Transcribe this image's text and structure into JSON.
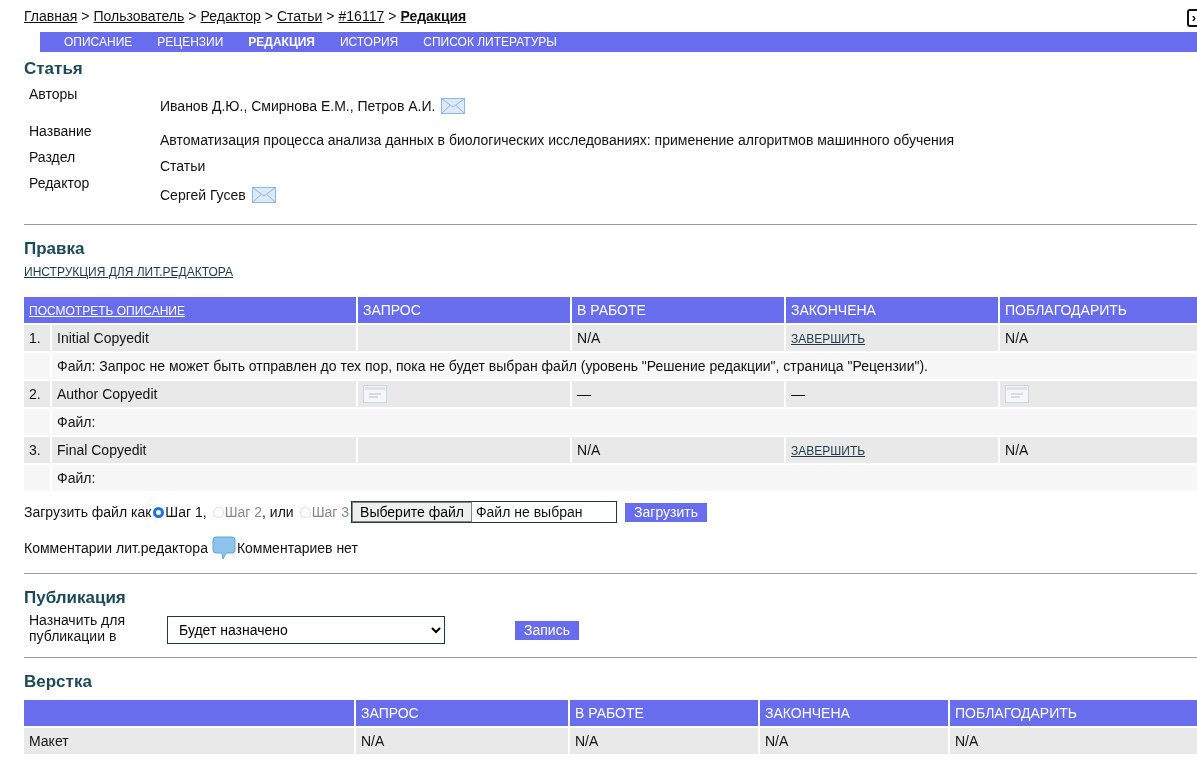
{
  "breadcrumbs": [
    {
      "label": "Главная",
      "current": false
    },
    {
      "label": "Пользователь",
      "current": false
    },
    {
      "label": "Редактор",
      "current": false
    },
    {
      "label": "Статьи",
      "current": false
    },
    {
      "label": "#16117",
      "current": false
    },
    {
      "label": "Редакция",
      "current": true
    }
  ],
  "separator": ">",
  "expand_button": {
    "label": "›"
  },
  "tabs": [
    {
      "label": "ОПИСАНИЕ",
      "selected": false
    },
    {
      "label": "РЕЦЕНЗИИ",
      "selected": false
    },
    {
      "label": "РЕДАКЦИЯ",
      "selected": true
    },
    {
      "label": "ИСТОРИЯ",
      "selected": false
    },
    {
      "label": "СПИСОК ЛИТЕРАТУРЫ",
      "selected": false
    }
  ],
  "article": {
    "heading": "Статья",
    "fields": [
      {
        "label": "Авторы",
        "value": "Иванов Д.Ю., Смирнова Е.М., Петров А.И.",
        "mail": true
      },
      {
        "label": "Название",
        "value": "Автоматизация процесса анализа данных в биологических исследованиях: применение алгоритмов машинного обучения",
        "mail": false
      },
      {
        "label": "Раздел",
        "value": "Статьи",
        "mail": false
      },
      {
        "label": "Редактор",
        "value": "Сергей Гусев",
        "mail": true
      }
    ]
  },
  "copyedit": {
    "heading": "Правка",
    "instructions_link": "ИНСТРУКЦИЯ ДЛЯ ЛИТ.РЕДАКТОРА",
    "columns": [
      {
        "label": "ПОСМОТРЕТЬ ОПИСАНИЕ",
        "kind": "link"
      },
      {
        "label": "ЗАПРОС",
        "kind": "text"
      },
      {
        "label": "В РАБОТЕ",
        "kind": "text"
      },
      {
        "label": "ЗАКОНЧЕНА",
        "kind": "text"
      },
      {
        "label": "ПОБЛАГОДАРИТЬ",
        "kind": "text"
      }
    ],
    "rows": [
      {
        "cells": [
          {
            "kind": "step",
            "number": "1.",
            "title": "Initial Copyedit"
          },
          {
            "kind": "empty"
          },
          {
            "kind": "text",
            "text": "N/A"
          },
          {
            "kind": "link",
            "text": "ЗАВЕРШИТЬ"
          },
          {
            "kind": "text",
            "text": "N/A"
          }
        ],
        "file": "Файл: Запрос не может быть отправлен до тех пор, пока не будет выбран файл (уровень \"Решение редакции\", страница \"Рецензии\")."
      },
      {
        "cells": [
          {
            "kind": "step",
            "number": "2.",
            "title": "Author Copyedit"
          },
          {
            "kind": "icon"
          },
          {
            "kind": "text",
            "text": "—"
          },
          {
            "kind": "text",
            "text": "—"
          },
          {
            "kind": "icon"
          }
        ],
        "file": "Файл:"
      },
      {
        "cells": [
          {
            "kind": "step",
            "number": "3.",
            "title": "Final Copyedit"
          },
          {
            "kind": "empty"
          },
          {
            "kind": "text",
            "text": "N/A"
          },
          {
            "kind": "link",
            "text": "ЗАВЕРШИТЬ"
          },
          {
            "kind": "text",
            "text": "N/A"
          }
        ],
        "file": "Файл:"
      }
    ],
    "upload": {
      "label": "Загрузить файл как",
      "options": [
        {
          "label": "Шаг 1",
          "suffix": ",",
          "selected": true,
          "disabled": false
        },
        {
          "label": "Шаг 2",
          "suffix": ", или",
          "selected": false,
          "disabled": true
        },
        {
          "label": "Шаг 3",
          "selected": false,
          "disabled": true
        }
      ],
      "choose_button": "Выберите файл",
      "file_status": "Файл не выбран",
      "submit": "Загрузить"
    },
    "comments": {
      "label": "Комментарии лит.редактора",
      "status": "Комментариев нет"
    }
  },
  "publication": {
    "heading": "Публикация",
    "label": "Назначить для публикации в",
    "value": "Будет назначено",
    "button": "Запись"
  },
  "layout": {
    "heading": "Верстка",
    "columns": [
      "",
      "ЗАПРОС",
      "В РАБОТЕ",
      "ЗАКОНЧЕНА",
      "ПОБЛАГОДАРИТЬ"
    ],
    "rows": [
      {
        "cells": [
          "Макет",
          "N/A",
          "N/A",
          "N/A",
          "N/A"
        ]
      }
    ]
  }
}
